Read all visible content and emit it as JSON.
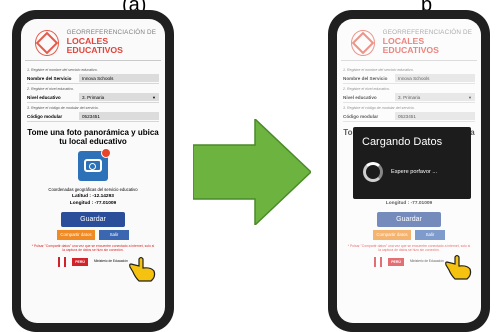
{
  "captions": {
    "left": "(a)",
    "right": "p"
  },
  "header": {
    "title_line1": "GEORREFERENCIACIÓN DE",
    "title_line2": "LOCALES EDUCATIVOS"
  },
  "form": {
    "step1": "1. Registre el nombre del servicio educativo.",
    "step2": "2. Registre el nivel educativo.",
    "step3": "3. Registre el código de modular del servicio.",
    "service_label": "Nombre del Servicio",
    "service_value": "Innova Schools",
    "level_label": "Nivel educativo",
    "level_value": "3. Primaria",
    "code_label": "Código modular",
    "code_value": "0523451"
  },
  "photo": {
    "instruction": "Tome una foto panorámica y ubica tu local educativo"
  },
  "coordinates": {
    "title": "Coordenadas geográficas del servicio educativo",
    "lat_label": "Latitud",
    "lat_value": ": -12.14293",
    "lon_label": "Longitud",
    "lon_value": ": -77.01009"
  },
  "buttons": {
    "save": "Guardar",
    "share": "Compartir datos",
    "exit": "Salir"
  },
  "note": "* Pulsar \"Compartir datos\" una vez que se encuentre conectado a internet, solo si la captura de datos se hizo sin conexión.",
  "footer": {
    "peru": "PERÚ",
    "ministry": "Ministerio de Educación"
  },
  "dialog": {
    "title": "Cargando Datos",
    "message": "Espere porfavor ..."
  },
  "colors": {
    "brand_red": "#e1443a",
    "save_blue": "#2a4e99",
    "share_orange": "#f08a24",
    "arrow_green": "#6cb33f"
  }
}
